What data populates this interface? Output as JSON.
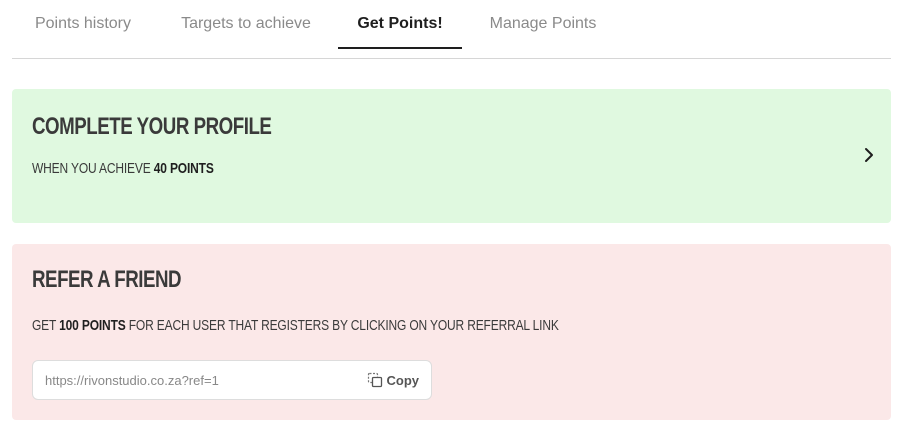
{
  "tabs": [
    {
      "label": "Points history",
      "active": false
    },
    {
      "label": "Targets to achieve",
      "active": false
    },
    {
      "label": "Get Points!",
      "active": true
    },
    {
      "label": "Manage Points",
      "active": false
    }
  ],
  "profile_card": {
    "title": "COMPLETE YOUR PROFILE",
    "subtitle_prefix": "WHEN YOU ACHIEVE ",
    "subtitle_points": "40 POINTS",
    "icon": "chevron-right-icon",
    "background": "#e0f9e0"
  },
  "refer_card": {
    "title": "REFER A FRIEND",
    "subtitle_prefix": "GET ",
    "subtitle_points": "100 POINTS",
    "subtitle_suffix": " FOR EACH USER THAT REGISTERS BY CLICKING ON YOUR REFERRAL LINK",
    "referral_link": "https://rivonstudio.co.za?ref=1",
    "copy_label": "Copy",
    "copy_icon": "copy-icon",
    "background": "#fbe8e8"
  }
}
